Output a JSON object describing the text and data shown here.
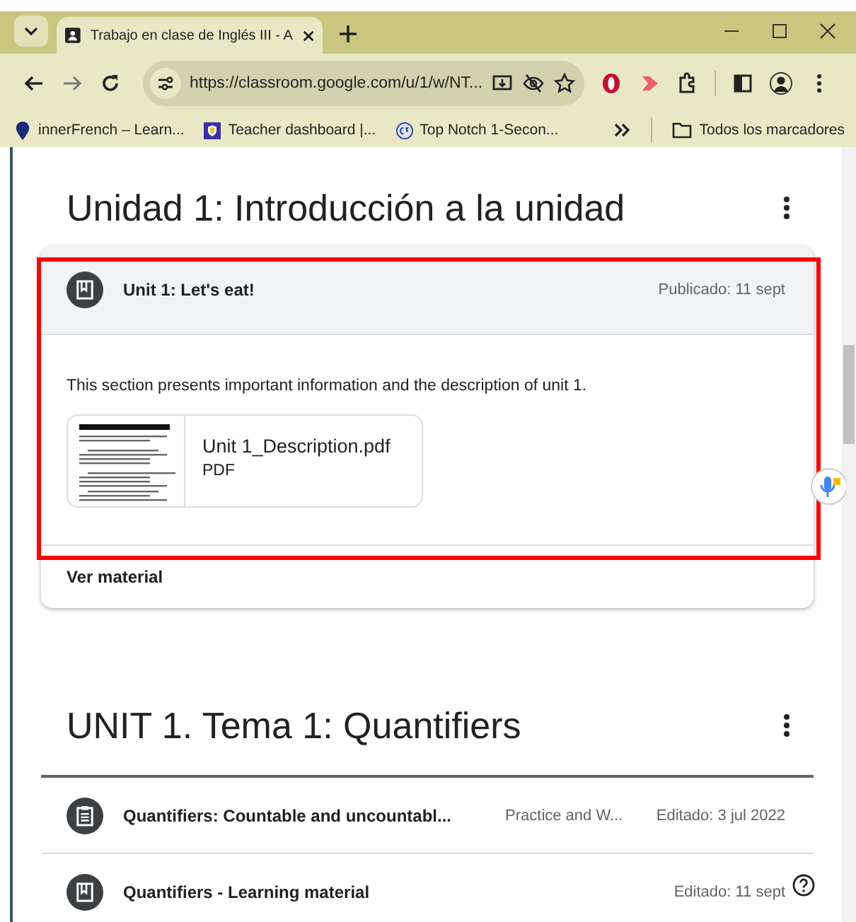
{
  "browser": {
    "tabs": [
      {
        "title": "Trabajo en clase de Inglés III - A",
        "selected": true
      }
    ],
    "url": "https://classroom.google.com/u/1/w/NT...",
    "bookmarks": [
      {
        "label": "innerFrench – Learn...",
        "kind": "pin"
      },
      {
        "label": "Teacher dashboard |...",
        "kind": "shield"
      },
      {
        "label": "Top Notch 1-Secon...",
        "kind": "cs"
      }
    ],
    "all_bookmarks": "Todos los marcadores"
  },
  "sections": [
    {
      "title": "Unidad 1: Introducción a la unidad",
      "items": [
        {
          "kind": "material",
          "title": "Unit 1: Let's eat!",
          "date": "Publicado: 11 sept",
          "expanded": true,
          "highlighted": true,
          "description": "This section presents important information and the description of unit 1.",
          "attachment": {
            "name": "Unit 1_Description.pdf",
            "type": "PDF"
          },
          "link": "Ver material"
        }
      ]
    },
    {
      "title": "UNIT 1. Tema 1: Quantifiers",
      "items": [
        {
          "kind": "assignment",
          "title": "Quantifiers: Countable and uncountabl...",
          "topic": "Practice and W...",
          "date": "Editado: 3 jul 2022",
          "expanded": false,
          "highlighted": false
        },
        {
          "kind": "material",
          "title": "Quantifiers - Learning material",
          "date": "Editado: 11 sept",
          "expanded": false,
          "highlighted": false
        }
      ]
    }
  ]
}
